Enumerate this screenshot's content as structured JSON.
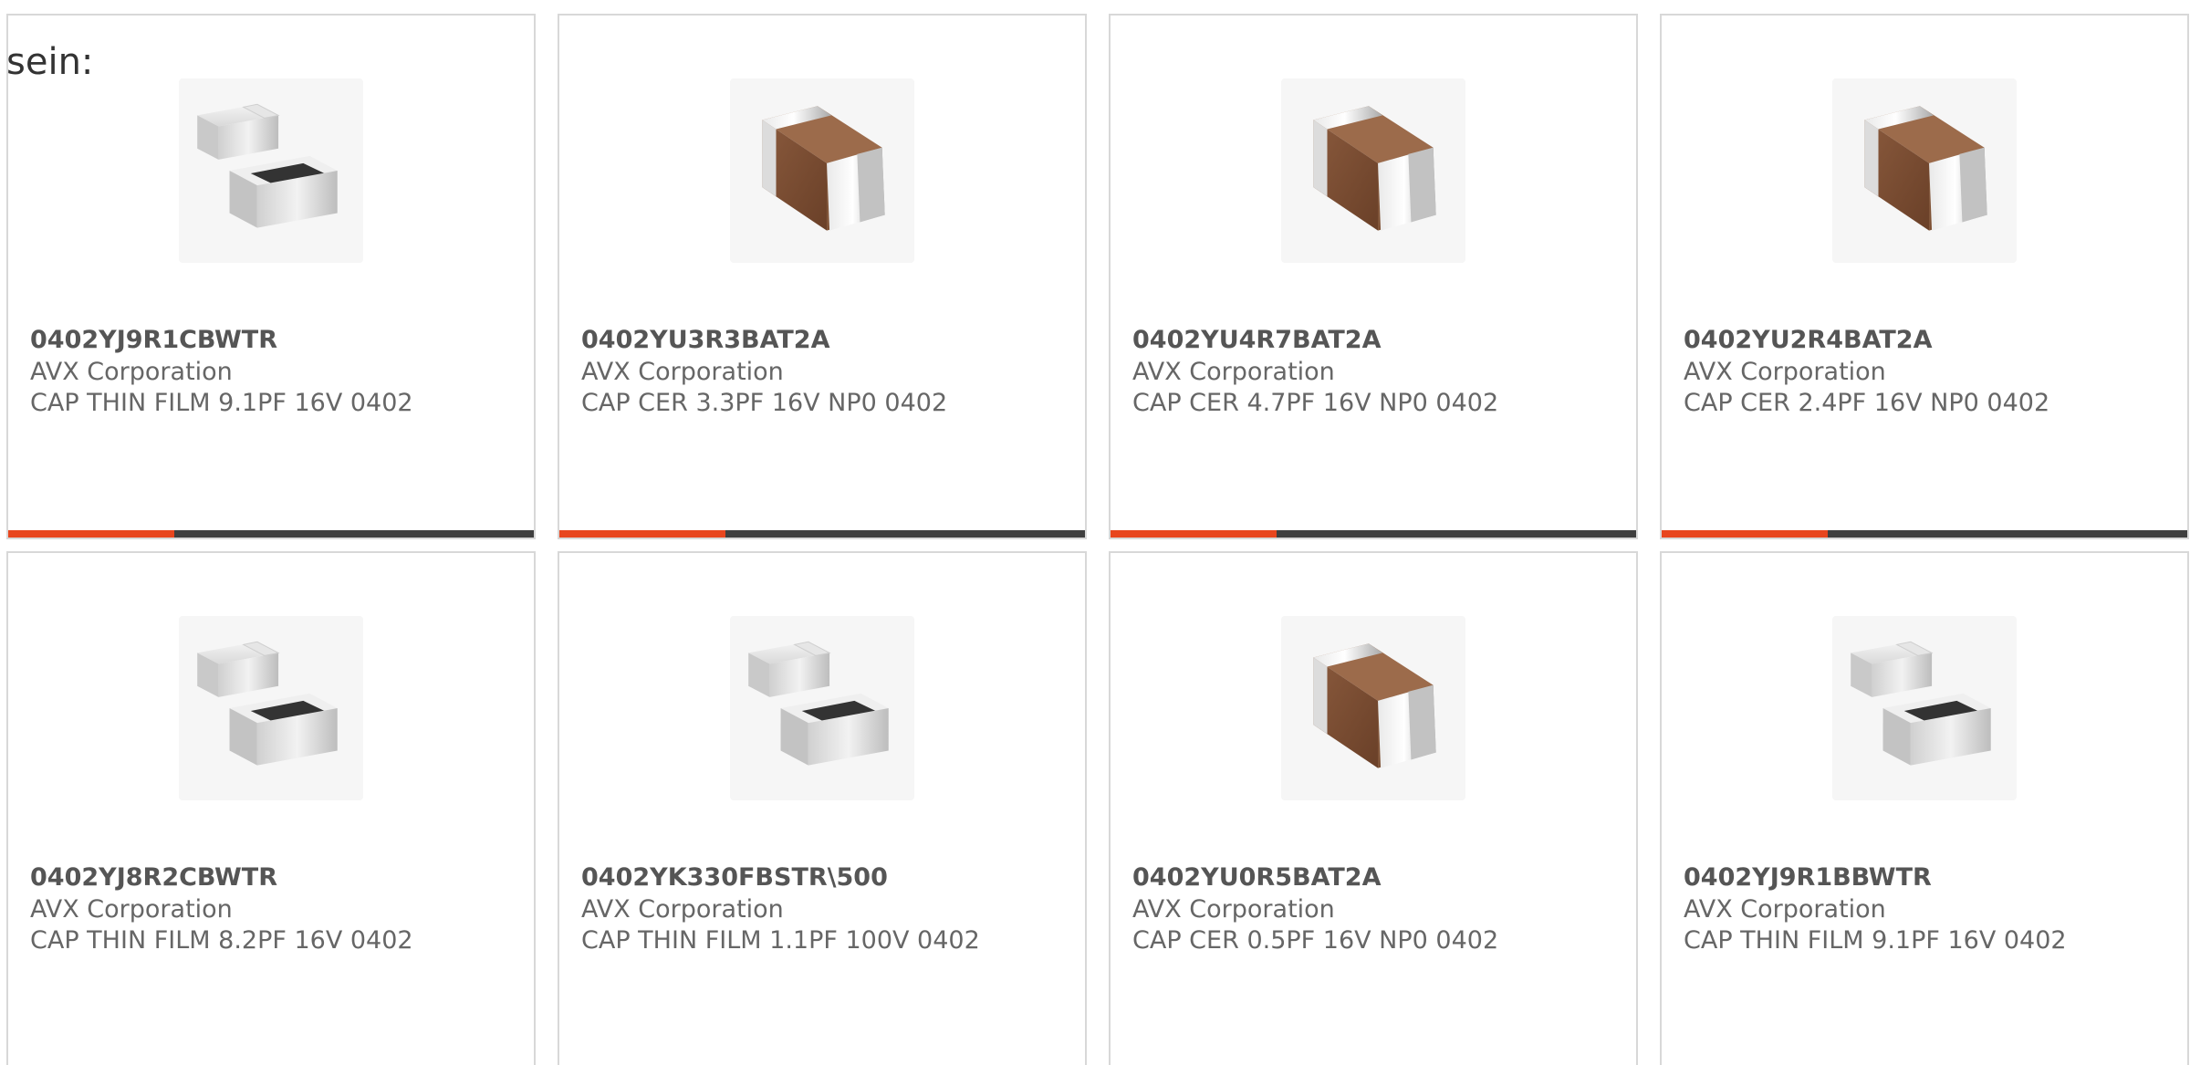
{
  "intro": {
    "text": "sein:"
  },
  "colors": {
    "accent": "#e8461e",
    "bar": "#3f3f3f",
    "border": "#d8d8d8",
    "text": "#666666"
  },
  "products": [
    {
      "part_number": "0402YJ9R1CBWTR",
      "manufacturer": "AVX Corporation",
      "description": "CAP THIN FILM 9.1PF 16V 0402",
      "image_icon": "thin-film-capacitor-icon"
    },
    {
      "part_number": "0402YU3R3BAT2A",
      "manufacturer": "AVX Corporation",
      "description": "CAP CER 3.3PF 16V NP0 0402",
      "image_icon": "ceramic-capacitor-icon"
    },
    {
      "part_number": "0402YU4R7BAT2A",
      "manufacturer": "AVX Corporation",
      "description": "CAP CER 4.7PF 16V NP0 0402",
      "image_icon": "ceramic-capacitor-icon"
    },
    {
      "part_number": "0402YU2R4BAT2A",
      "manufacturer": "AVX Corporation",
      "description": "CAP CER 2.4PF 16V NP0 0402",
      "image_icon": "ceramic-capacitor-icon"
    },
    {
      "part_number": "0402YJ8R2CBWTR",
      "manufacturer": "AVX Corporation",
      "description": "CAP THIN FILM 8.2PF 16V 0402",
      "image_icon": "thin-film-capacitor-icon"
    },
    {
      "part_number": "0402YK330FBSTR\\500",
      "manufacturer": "AVX Corporation",
      "description": "CAP THIN FILM 1.1PF 100V 0402",
      "image_icon": "thin-film-capacitor-icon"
    },
    {
      "part_number": "0402YU0R5BAT2A",
      "manufacturer": "AVX Corporation",
      "description": "CAP CER 0.5PF 16V NP0 0402",
      "image_icon": "ceramic-capacitor-icon"
    },
    {
      "part_number": "0402YJ9R1BBWTR",
      "manufacturer": "AVX Corporation",
      "description": "CAP THIN FILM 9.1PF 16V 0402",
      "image_icon": "thin-film-capacitor-icon"
    }
  ]
}
